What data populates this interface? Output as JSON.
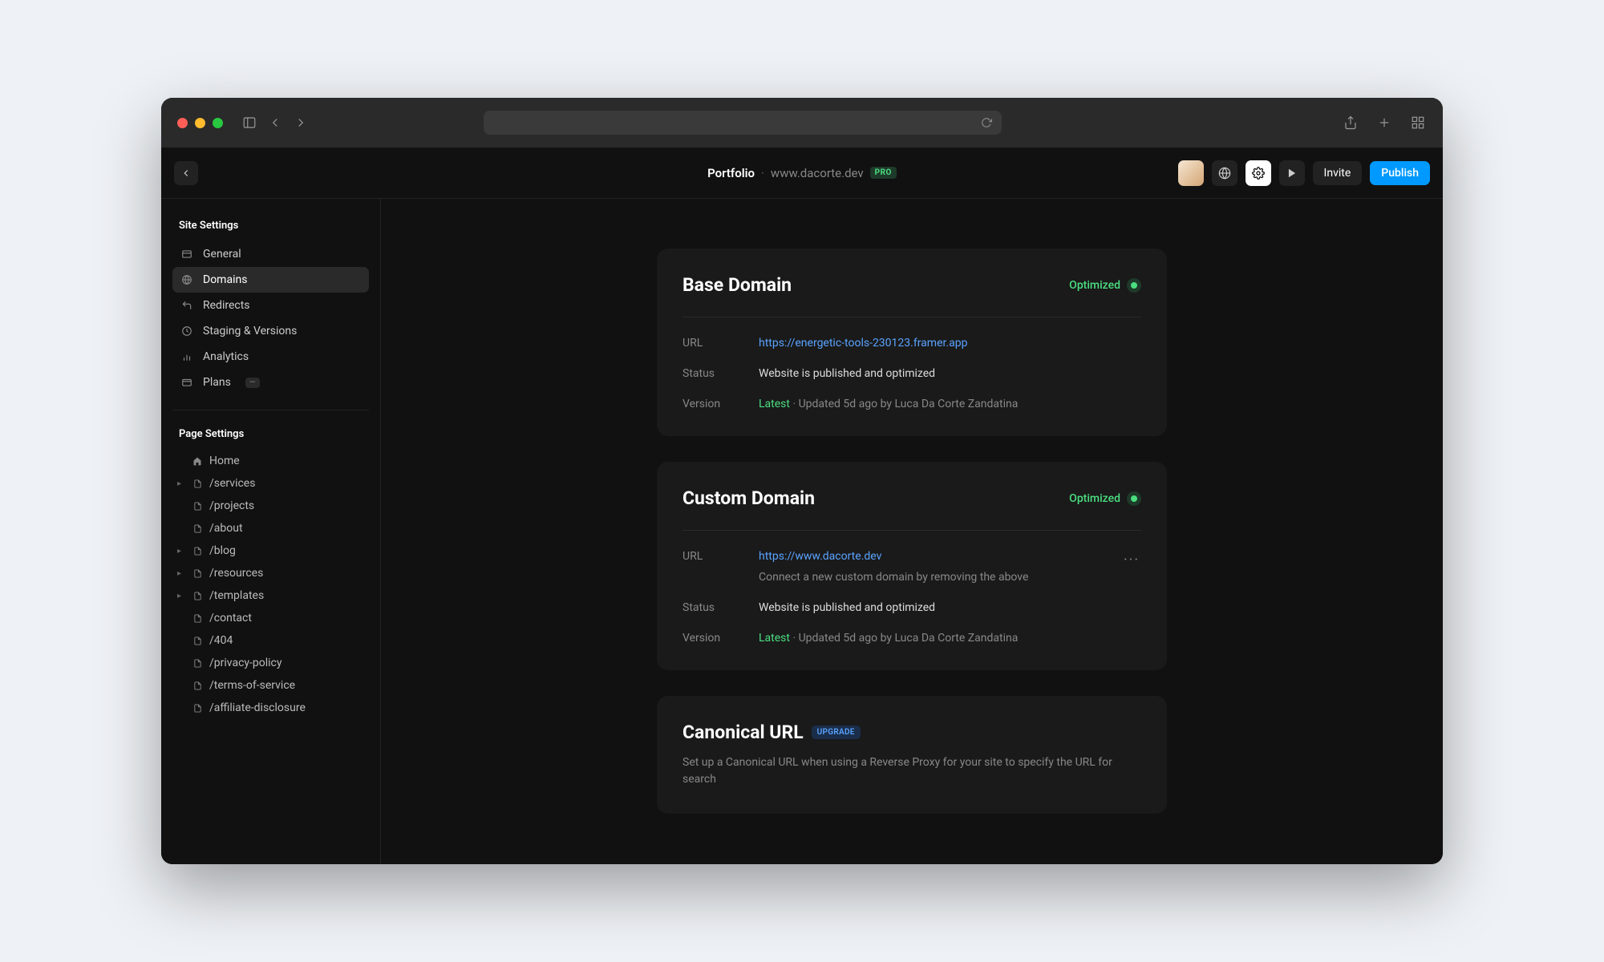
{
  "topbar": {
    "site_name": "Portfolio",
    "site_domain": "www.dacorte.dev",
    "plan_badge": "PRO",
    "invite_label": "Invite",
    "publish_label": "Publish"
  },
  "sidebar": {
    "site_settings_title": "Site Settings",
    "site_items": [
      {
        "label": "General"
      },
      {
        "label": "Domains"
      },
      {
        "label": "Redirects"
      },
      {
        "label": "Staging & Versions"
      },
      {
        "label": "Analytics"
      },
      {
        "label": "Plans"
      }
    ],
    "plans_badge": "—",
    "page_settings_title": "Page Settings",
    "pages": [
      {
        "label": "Home",
        "expandable": false,
        "icon": "home"
      },
      {
        "label": "/services",
        "expandable": true,
        "icon": "page"
      },
      {
        "label": "/projects",
        "expandable": false,
        "icon": "page"
      },
      {
        "label": "/about",
        "expandable": false,
        "icon": "page"
      },
      {
        "label": "/blog",
        "expandable": true,
        "icon": "page"
      },
      {
        "label": "/resources",
        "expandable": true,
        "icon": "page"
      },
      {
        "label": "/templates",
        "expandable": true,
        "icon": "page"
      },
      {
        "label": "/contact",
        "expandable": false,
        "icon": "page"
      },
      {
        "label": "/404",
        "expandable": false,
        "icon": "page"
      },
      {
        "label": "/privacy-policy",
        "expandable": false,
        "icon": "page"
      },
      {
        "label": "/terms-of-service",
        "expandable": false,
        "icon": "page"
      },
      {
        "label": "/affiliate-disclosure",
        "expandable": false,
        "icon": "page"
      }
    ]
  },
  "base_domain": {
    "title": "Base Domain",
    "status_label": "Optimized",
    "url_label": "URL",
    "url_value": "https://energetic-tools-230123.framer.app",
    "status_row_label": "Status",
    "status_value": "Website is published and optimized",
    "version_label": "Version",
    "version_link": "Latest",
    "version_rest": " · Updated 5d ago by Luca Da Corte Zandatina"
  },
  "custom_domain": {
    "title": "Custom Domain",
    "status_label": "Optimized",
    "url_label": "URL",
    "url_value": "https://www.dacorte.dev",
    "url_hint": "Connect a new custom domain by removing the above",
    "status_row_label": "Status",
    "status_value": "Website is published and optimized",
    "version_label": "Version",
    "version_link": "Latest",
    "version_rest": " · Updated 5d ago by Luca Da Corte Zandatina"
  },
  "canonical": {
    "title": "Canonical URL",
    "badge": "UPGRADE",
    "description": "Set up a Canonical URL when using a Reverse Proxy for your site to specify the URL for search"
  }
}
